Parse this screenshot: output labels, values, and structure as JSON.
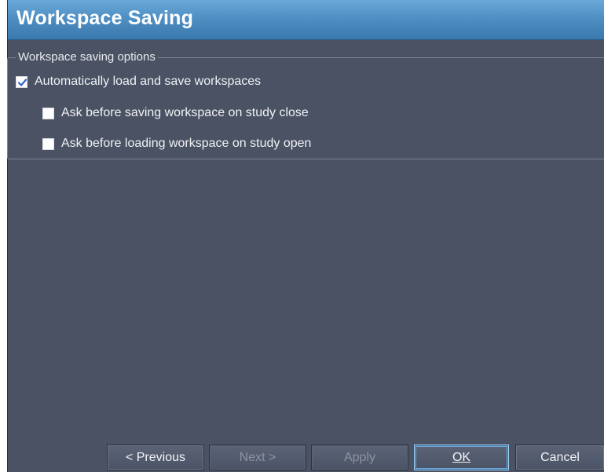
{
  "window": {
    "title": "Workspace Saving"
  },
  "group": {
    "legend": "Workspace saving options",
    "options": [
      {
        "label": "Automatically load and save workspaces",
        "checked": true
      },
      {
        "label": "Ask before saving workspace on study close",
        "checked": false
      },
      {
        "label": "Ask before loading workspace on study open",
        "checked": false
      }
    ]
  },
  "buttons": {
    "previous": "< Previous",
    "next": "Next >",
    "apply": "Apply",
    "ok": "OK",
    "cancel": "Cancel"
  },
  "colors": {
    "titlebar": "#4f8fc4",
    "panel_background": "#4a5264",
    "default_button_border": "#9fd0f5"
  }
}
